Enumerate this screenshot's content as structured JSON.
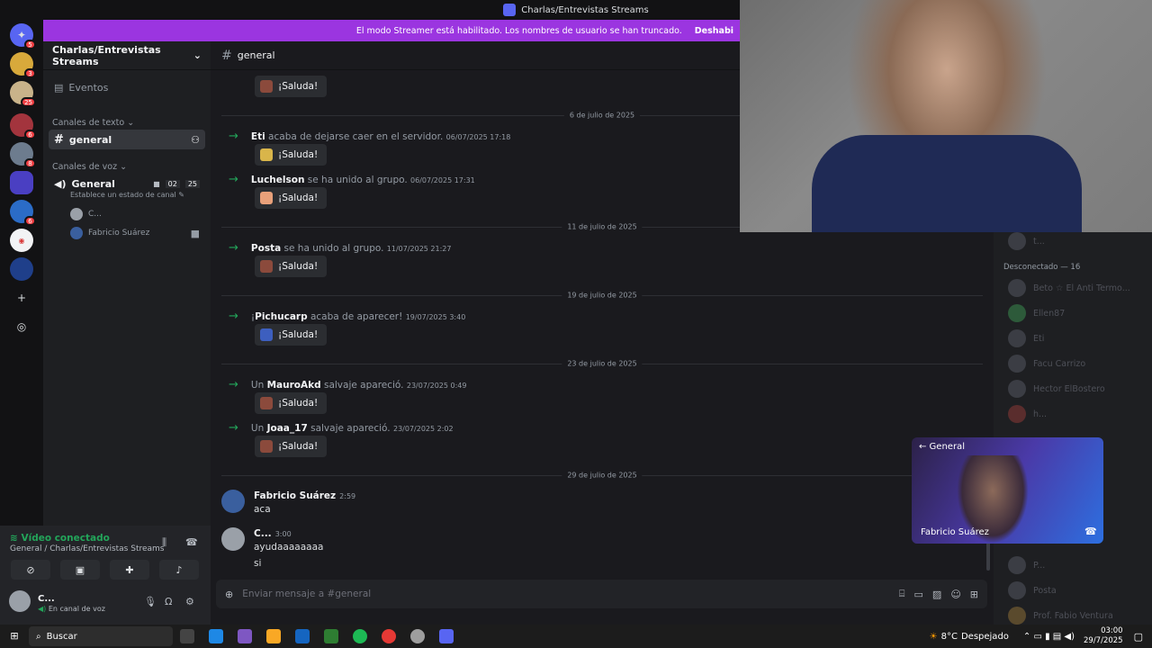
{
  "window": {
    "title": "Charlas/Entrevistas Streams"
  },
  "banner": {
    "text": "El modo Streamer está habilitado. Los nombres de usuario se han truncado.",
    "button": "Deshabi"
  },
  "server_rail": {
    "badges": [
      "5",
      "3",
      "25",
      "6",
      "8",
      "6"
    ]
  },
  "sidebar": {
    "server_name": "Charlas/Entrevistas Streams",
    "events": "Eventos",
    "text_category": "Canales de texto",
    "text_channel": "general",
    "voice_category": "Canales de voz",
    "voice_channel": "General",
    "voice_counts": {
      "video": "02",
      "users": "25"
    },
    "voice_status": "Establece un estado de canal",
    "voice_users": [
      "C...",
      "Fabricio Suárez"
    ]
  },
  "voice_panel": {
    "status": "Vídeo conectado",
    "location": "General / Charlas/Entrevistas Streams",
    "user": "C...",
    "user_status": "En canal de voz"
  },
  "chat_header": {
    "channel": "general"
  },
  "chat": {
    "saluda": "¡Saluda!",
    "dividers": [
      "6 de julio de 2025",
      "11 de julio de 2025",
      "19 de julio de 2025",
      "23 de julio de 2025",
      "29 de julio de 2025"
    ],
    "joins": [
      {
        "name": "Eti",
        "pre": "",
        "text": "acaba de dejarse caer en el servidor.",
        "time": "06/07/2025 17:18"
      },
      {
        "name": "Luchelson",
        "pre": "",
        "text": "se ha unido al grupo.",
        "time": "06/07/2025 17:31"
      },
      {
        "name": "Posta",
        "pre": "",
        "text": "se ha unido al grupo.",
        "time": "11/07/2025 21:27"
      },
      {
        "name": "Pichucarp",
        "pre": "¡",
        "text": "acaba de aparecer!",
        "time": "19/07/2025 3:40"
      },
      {
        "name": "MauroAkd",
        "pre": "Un ",
        "text": "salvaje apareció.",
        "time": "23/07/2025 0:49"
      },
      {
        "name": "Joaa_17",
        "pre": "Un ",
        "text": "salvaje apareció.",
        "time": "23/07/2025 2:02"
      }
    ],
    "messages": [
      {
        "author": "Fabricio Suárez",
        "time": "2:59",
        "lines": [
          "aca"
        ]
      },
      {
        "author": "C...",
        "time": "3:00",
        "lines": [
          "ayudaaaaaaaa",
          "si"
        ]
      }
    ]
  },
  "composer": {
    "placeholder": "Enviar mensaje a #general"
  },
  "members": {
    "offline_header": "Desconectado — 16",
    "top": "t...",
    "offline": [
      "Beto ☆ El Anti Termo...",
      "Ellen87",
      "Eti",
      "Facu Carrizo",
      "Hector ElBostero",
      "h..."
    ],
    "bottom": [
      "P...",
      "Posta",
      "Prof. Fabio Ventura"
    ]
  },
  "pip": {
    "back": "← General",
    "name": "Fabricio Suárez"
  },
  "taskbar": {
    "search": "Buscar",
    "weather": "8°C",
    "weather_desc": "Despejado",
    "time": "03:00",
    "date": "29/7/2025"
  }
}
